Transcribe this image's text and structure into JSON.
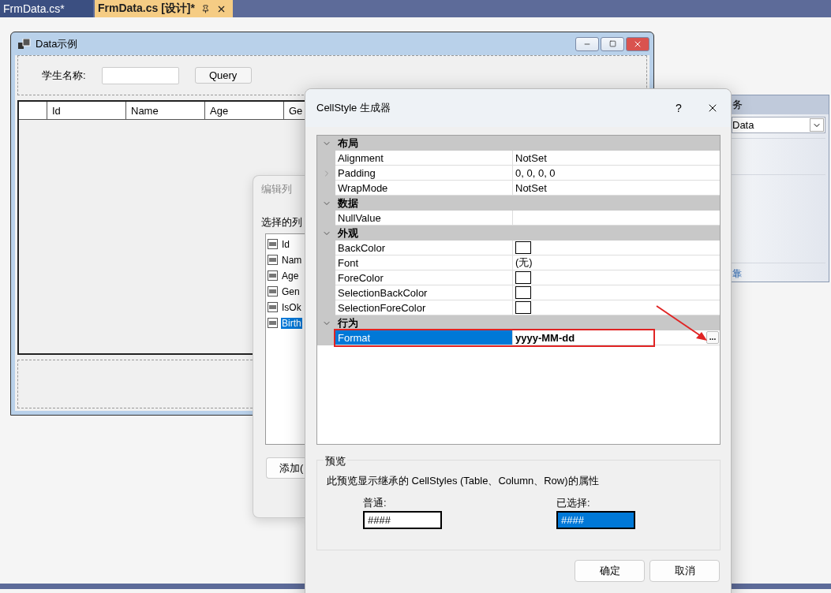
{
  "tabs": [
    {
      "label": "FrmData.cs*",
      "selected": false
    },
    {
      "label": "FrmData.cs [设计]*",
      "selected": true
    }
  ],
  "form": {
    "title": "Data示例",
    "search_label": "学生名称:",
    "query_button": "Query",
    "grid_columns": [
      "Id",
      "Name",
      "Age",
      "Ge"
    ]
  },
  "tasks_panel": {
    "title": "务",
    "data_source": "Data",
    "link": "靠"
  },
  "edit_columns_dialog": {
    "title": "编辑列",
    "list_label": "选择的列",
    "columns": [
      {
        "name": "Id",
        "selected": false
      },
      {
        "name": "Nam",
        "selected": false
      },
      {
        "name": "Age",
        "selected": false
      },
      {
        "name": "Gen",
        "selected": false
      },
      {
        "name": "IsOk",
        "selected": false
      },
      {
        "name": "Birth",
        "selected": true
      }
    ],
    "add_button": "添加("
  },
  "cellstyle_dialog": {
    "title": "CellStyle 生成器",
    "help": "?",
    "annotation": {
      "kind": "arrow"
    },
    "sections": [
      {
        "title": "布局",
        "expanded": true,
        "properties": [
          {
            "name": "Alignment",
            "kind": "text",
            "value": "NotSet",
            "expandable": false,
            "selected": false,
            "modified": false,
            "highlighted": false
          },
          {
            "name": "Padding",
            "kind": "text",
            "value": "0, 0, 0, 0",
            "expandable": true,
            "selected": false,
            "modified": false,
            "highlighted": false
          },
          {
            "name": "WrapMode",
            "kind": "text",
            "value": "NotSet",
            "expandable": false,
            "selected": false,
            "modified": false,
            "highlighted": false
          }
        ]
      },
      {
        "title": "数据",
        "expanded": true,
        "properties": [
          {
            "name": "NullValue",
            "kind": "text",
            "expandable": false,
            "selected": false,
            "highlighted": false
          }
        ]
      },
      {
        "title": "外观",
        "expanded": true,
        "properties": [
          {
            "name": "BackColor",
            "kind": "color",
            "expandable": false,
            "selected": false,
            "highlighted": false
          },
          {
            "name": "Font",
            "kind": "text",
            "value": "(无)",
            "expandable": false,
            "selected": false,
            "modified": false,
            "highlighted": false
          },
          {
            "name": "ForeColor",
            "kind": "color",
            "expandable": false,
            "selected": false,
            "highlighted": false
          },
          {
            "name": "SelectionBackColor",
            "kind": "color",
            "expandable": false,
            "selected": false,
            "highlighted": false
          },
          {
            "name": "SelectionForeColor",
            "kind": "color",
            "expandable": false,
            "selected": false,
            "highlighted": false
          }
        ]
      },
      {
        "title": "行为",
        "expanded": true,
        "properties": [
          {
            "name": "Format",
            "kind": "text",
            "value": "yyyy-MM-dd",
            "button": "...",
            "expandable": false,
            "selected": true,
            "modified": true,
            "highlighted": true
          }
        ]
      }
    ],
    "preview": {
      "title": "预览",
      "description": "此预览显示继承的 CellStyles (Table、Column、Row)的属性",
      "normal_label": "普通:",
      "normal_sample": "####",
      "selected_label": "已选择:",
      "selected_sample": "####"
    },
    "buttons": [
      "确定",
      "取消"
    ]
  }
}
